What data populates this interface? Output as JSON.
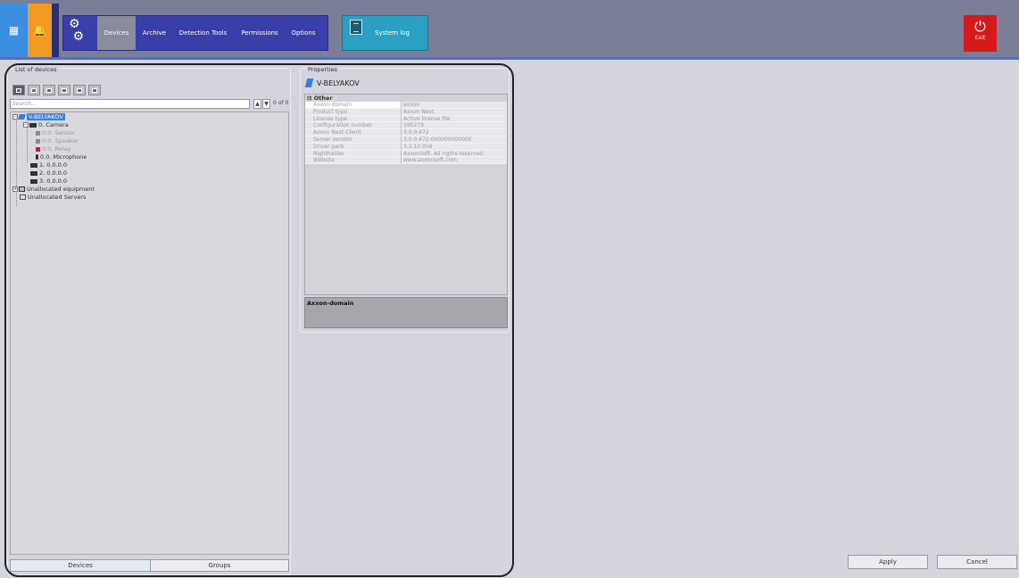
{
  "topbar": {
    "nav": {
      "devices": "Devices",
      "archive": "Archive",
      "detection_tools": "Detection Tools",
      "permissions": "Permissions",
      "options": "Options"
    },
    "system_log": "System log",
    "exit": "Exit",
    "colors": {
      "blue_tile": "#3a8fe0",
      "orange_tile": "#f39a23",
      "nav_group": "#3a3ea8",
      "log_group": "#2aa0c2",
      "exit": "#d41a1a"
    }
  },
  "devices_panel": {
    "title": "List of devices",
    "search_placeholder": "Search...",
    "match_count": "0 of 0",
    "tree": {
      "server": "V-BELYAKOV",
      "camera": "0. Camera",
      "sensor": "0.0. Sensor",
      "speaker": "0.0. Speaker",
      "relay": "0.0. Relay",
      "microphone": "0.0. Microphone",
      "cam1": "1. 0.0.0.0",
      "cam2": "2. 0.0.0.0",
      "cam3": "3. 0.0.0.0",
      "unallocated_equipment": "Unallocated equipment",
      "unallocated_servers": "Unallocated Servers"
    },
    "tabs": {
      "devices": "Devices",
      "groups": "Groups"
    }
  },
  "properties_panel": {
    "title": "Properties",
    "header": "V-BELYAKOV",
    "category": "Other",
    "rows": [
      {
        "name": "Axxon-domain",
        "value": "axxon"
      },
      {
        "name": "Product type",
        "value": "Axxon Next"
      },
      {
        "name": "License type",
        "value": "Active license file"
      },
      {
        "name": "Configuration number",
        "value": "195279"
      },
      {
        "name": "Axxon Next Client",
        "value": "3.0.0.472"
      },
      {
        "name": "Server version",
        "value": "3.0.0.472-000000000000"
      },
      {
        "name": "Driver pack",
        "value": "3.2.10.958"
      },
      {
        "name": "Rightholder",
        "value": "AxxonSoft. All rigths reserved."
      },
      {
        "name": "Website",
        "value": "www.axxonsoft.com"
      }
    ],
    "description_title": "Axxon-domain"
  },
  "buttons": {
    "apply": "Apply",
    "cancel": "Cancel"
  }
}
